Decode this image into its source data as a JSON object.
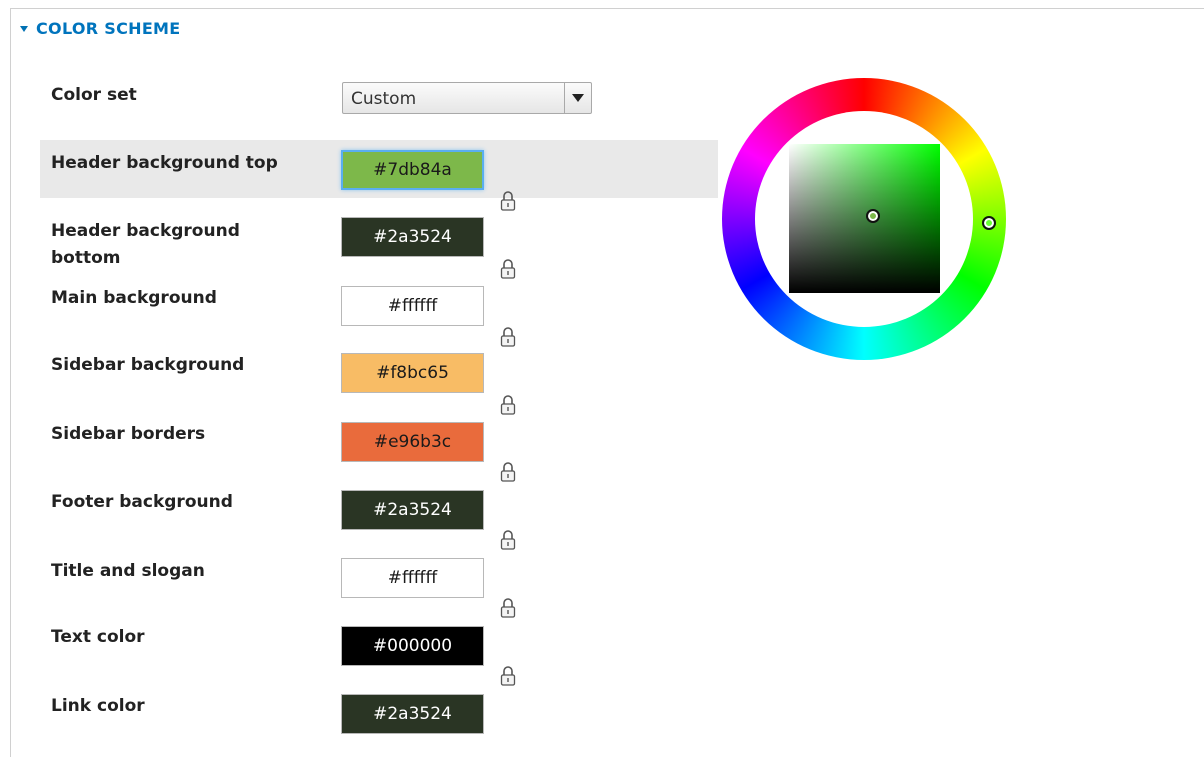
{
  "section": {
    "title": "COLOR SCHEME"
  },
  "color_set": {
    "label": "Color set",
    "selected": "Custom"
  },
  "fields": [
    {
      "label": "Header background top",
      "value": "#7db84a",
      "bg": "#7db84a",
      "fg": "#1a1a1a"
    },
    {
      "label": "Header background bottom",
      "value": "#2a3524",
      "bg": "#2a3524",
      "fg": "#ffffff"
    },
    {
      "label": "Main background",
      "value": "#ffffff",
      "bg": "#ffffff",
      "fg": "#1a1a1a"
    },
    {
      "label": "Sidebar background",
      "value": "#f8bc65",
      "bg": "#f8bc65",
      "fg": "#1a1a1a"
    },
    {
      "label": "Sidebar borders",
      "value": "#e96b3c",
      "bg": "#e96b3c",
      "fg": "#1a1a1a"
    },
    {
      "label": "Footer background",
      "value": "#2a3524",
      "bg": "#2a3524",
      "fg": "#ffffff"
    },
    {
      "label": "Title and slogan",
      "value": "#ffffff",
      "bg": "#ffffff",
      "fg": "#1a1a1a"
    },
    {
      "label": "Text color",
      "value": "#000000",
      "bg": "#000000",
      "fg": "#ffffff"
    },
    {
      "label": "Link color",
      "value": "#2a3524",
      "bg": "#2a3524",
      "fg": "#ffffff"
    }
  ],
  "icons": {
    "collapse": "triangle-down-icon",
    "lock": "lock-icon",
    "dropdown": "chevron-down-icon"
  },
  "colors": {
    "accent": "#0074bd",
    "highlight_row": "#e9e9e9",
    "focus_ring": "#5aaef0"
  }
}
